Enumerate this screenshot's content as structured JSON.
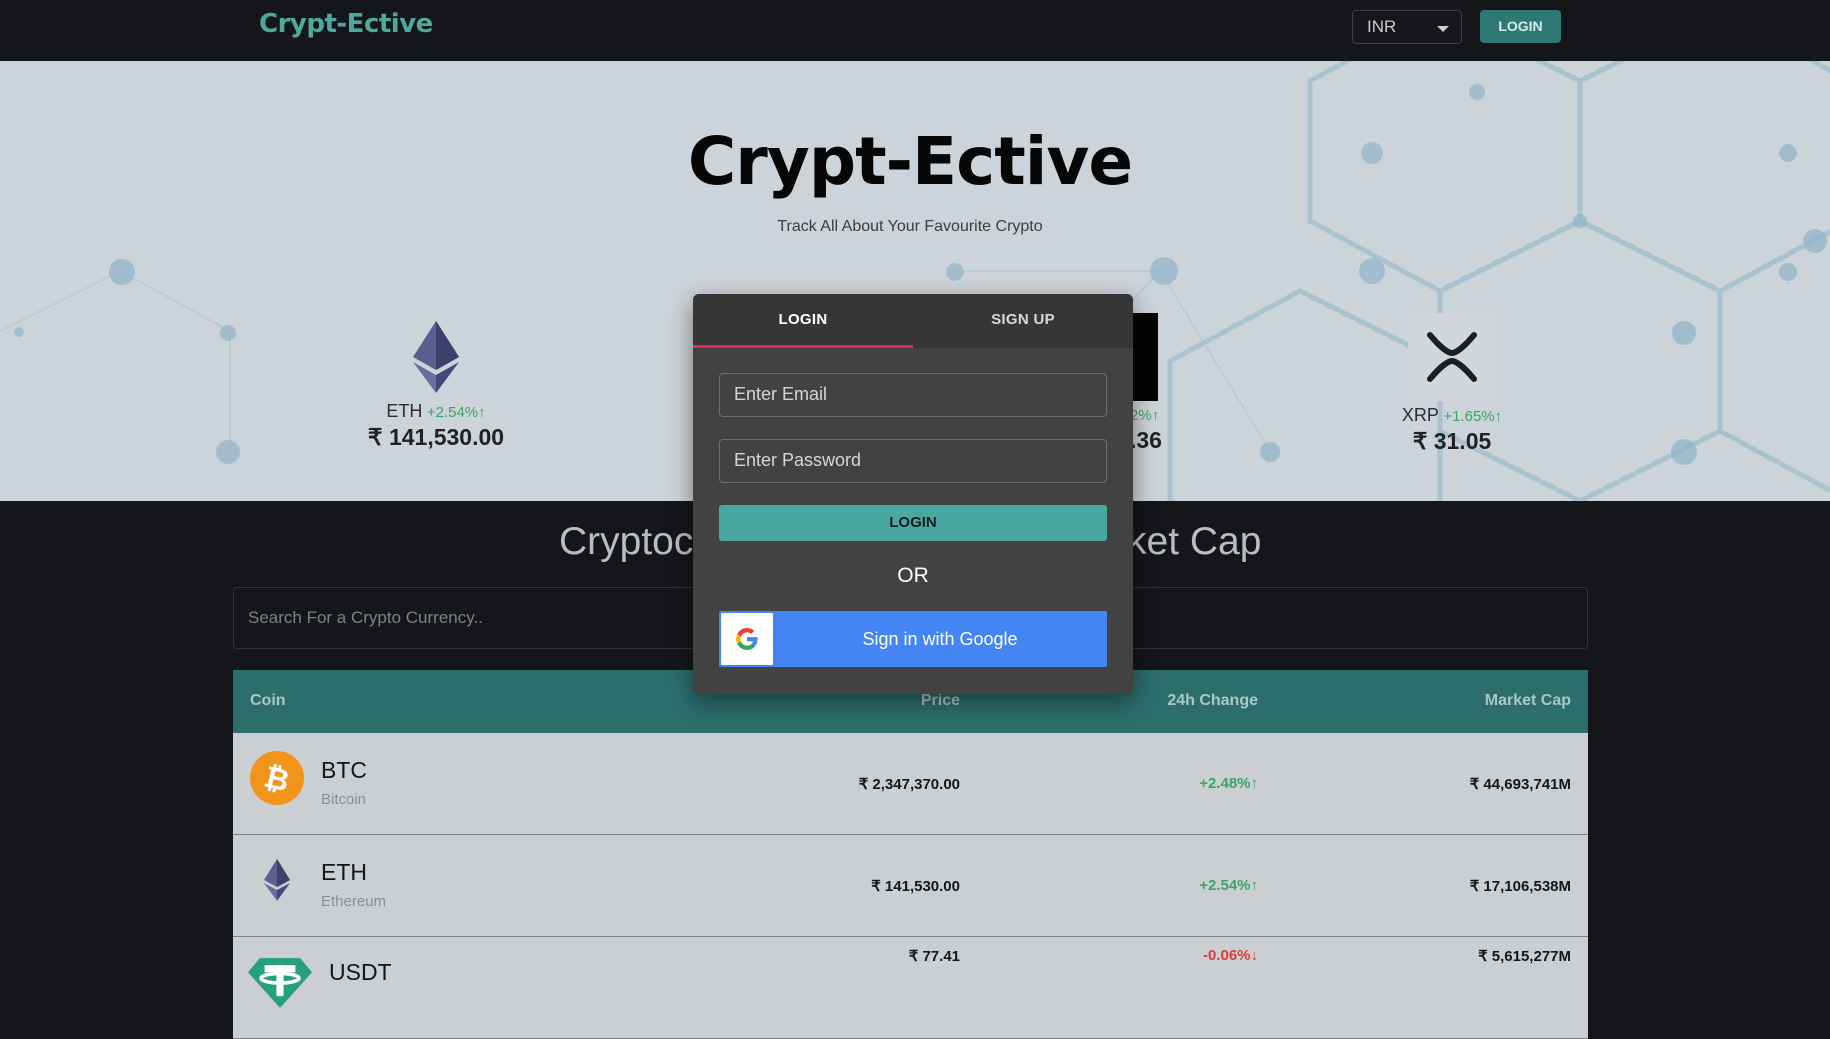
{
  "header": {
    "logo": "Crypt-Ective",
    "currency": "INR",
    "login_label": "LOGIN"
  },
  "hero": {
    "title": "Crypt-Ective",
    "subtitle": "Track All About Your Favourite Crypto",
    "carousel": [
      {
        "symbol": "ETH",
        "change": "+2.54%",
        "price": "₹ 141,530.00"
      },
      {
        "symbol": "",
        "change": "2%",
        "price": ".36"
      },
      {
        "symbol": "XRP",
        "change": "+1.65%",
        "price": "₹ 31.05"
      }
    ]
  },
  "main": {
    "section_title_left": "Cryptoc",
    "section_title_right": "ket Cap",
    "search_placeholder": "Search For a Crypto Currency.."
  },
  "table": {
    "headers": {
      "coin": "Coin",
      "price": "Price",
      "change": "24h Change",
      "market_cap": "Market Cap"
    },
    "rows": [
      {
        "symbol": "BTC",
        "name": "Bitcoin",
        "price": "₹ 2,347,370.00",
        "change": "+2.48%",
        "market_cap": "₹ 44,693,741M"
      },
      {
        "symbol": "ETH",
        "name": "Ethereum",
        "price": "₹ 141,530.00",
        "change": "+2.54%",
        "market_cap": "₹ 17,106,538M"
      },
      {
        "symbol": "USDT",
        "name": "",
        "price": "₹ 77.41",
        "change": "-0.06%",
        "market_cap": "₹ 5,615,277M"
      }
    ]
  },
  "modal": {
    "tab_login": "LOGIN",
    "tab_signup": "SIGN UP",
    "email_placeholder": "Enter Email",
    "password_placeholder": "Enter Password",
    "login_label": "LOGIN",
    "or_label": "OR",
    "google_label": "Sign in with Google"
  },
  "colors": {
    "accent": "#4ea89e",
    "positive": "#3aa467",
    "negative": "#d34040",
    "tab_indicator": "#e8265c",
    "google": "#4585f3"
  },
  "icons": {
    "eth": "ethereum-icon",
    "xrp": "xrp-icon",
    "btc": "bitcoin-icon",
    "usdt": "tether-icon",
    "google": "google-g-icon"
  }
}
